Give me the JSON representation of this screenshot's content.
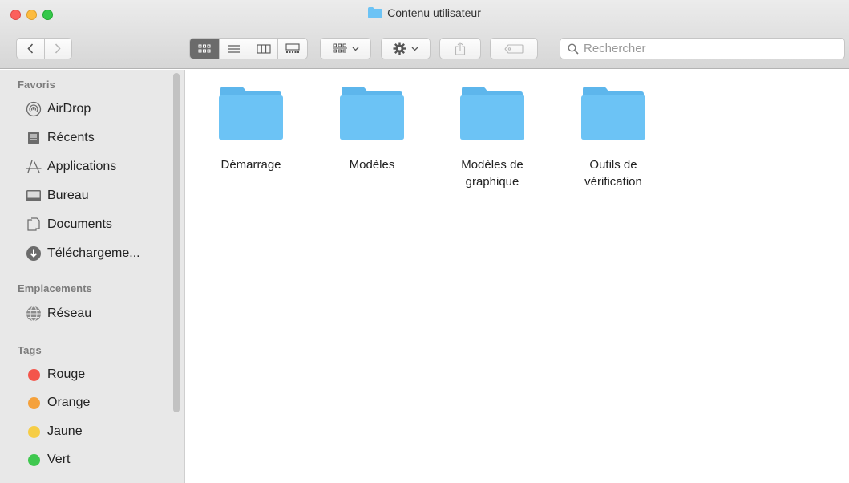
{
  "window": {
    "title": "Contenu utilisateur"
  },
  "toolbar": {
    "back_icon": "chevron-left-icon",
    "forward_icon": "chevron-right-icon",
    "views": [
      "icon-view-icon",
      "list-view-icon",
      "column-view-icon",
      "gallery-view-icon"
    ],
    "group_icon": "group-grid-icon",
    "action_icon": "gear-icon",
    "share_icon": "share-icon",
    "tag_icon": "tag-icon"
  },
  "search": {
    "placeholder": "Rechercher"
  },
  "sidebar": {
    "favorites_heading": "Favoris",
    "favorites": [
      {
        "label": "AirDrop",
        "icon": "airdrop-icon"
      },
      {
        "label": "Récents",
        "icon": "recents-icon"
      },
      {
        "label": "Applications",
        "icon": "applications-icon"
      },
      {
        "label": "Bureau",
        "icon": "desktop-icon"
      },
      {
        "label": "Documents",
        "icon": "documents-icon"
      },
      {
        "label": "Téléchargeme...",
        "icon": "downloads-icon"
      }
    ],
    "locations_heading": "Emplacements",
    "locations": [
      {
        "label": "Réseau",
        "icon": "network-icon"
      }
    ],
    "tags_heading": "Tags",
    "tags": [
      {
        "label": "Rouge",
        "color": "#f4554b"
      },
      {
        "label": "Orange",
        "color": "#f5a13b"
      },
      {
        "label": "Jaune",
        "color": "#f6cd45"
      },
      {
        "label": "Vert",
        "color": "#3fc84f"
      }
    ]
  },
  "files": [
    {
      "label": "Démarrage"
    },
    {
      "label": "Modèles"
    },
    {
      "label": "Modèles de graphique"
    },
    {
      "label": "Outils de vérification"
    }
  ],
  "colors": {
    "folder": "#6cc3f5",
    "folder_tab": "#5db6ec"
  }
}
